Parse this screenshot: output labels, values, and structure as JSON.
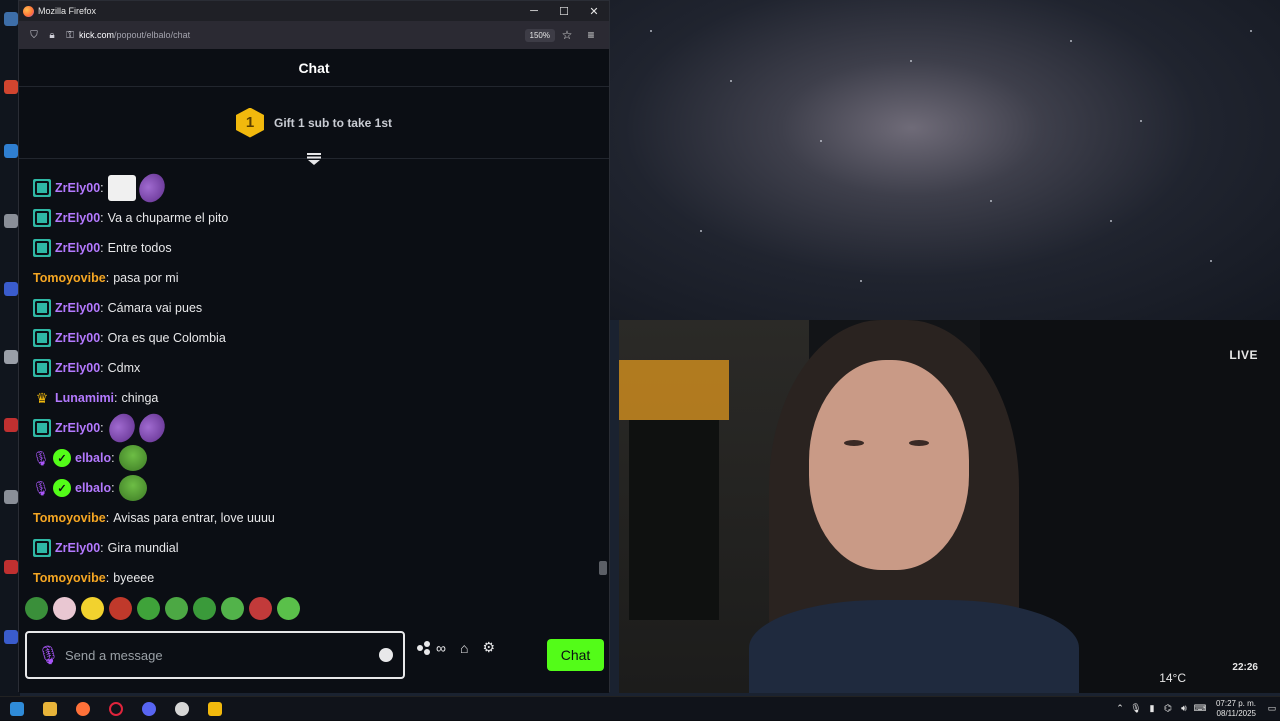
{
  "browser": {
    "window_title": "Mozilla Firefox",
    "url_host": "kick.com",
    "url_path": "/popout/elbalo/chat",
    "zoom": "150%"
  },
  "chat": {
    "header": "Chat",
    "gift_rank": "1",
    "gift_text": "Gift 1 sub to take 1st",
    "messages": [
      {
        "user": "ZrEly00",
        "text": "",
        "emotes": [
          "paper",
          "eggplant"
        ]
      },
      {
        "user": "ZrEly00",
        "text": "Va a chuparme el pito"
      },
      {
        "user": "ZrEly00",
        "text": "Entre todos"
      },
      {
        "user": "Tomoyovibe",
        "text": "pasa por mi"
      },
      {
        "user": "ZrEly00",
        "text": "Cámara vai pues"
      },
      {
        "user": "ZrEly00",
        "text": "Ora es que Colombia"
      },
      {
        "user": "ZrEly00",
        "text": "Cdmx"
      },
      {
        "user": "Lunamimi",
        "text": "chinga"
      },
      {
        "user": "ZrEly00",
        "text": "",
        "emotes": [
          "eggplant",
          "eggplant"
        ]
      },
      {
        "user": "elbalo",
        "text": "",
        "emotes": [
          "frog"
        ]
      },
      {
        "user": "elbalo",
        "text": "",
        "emotes": [
          "frog"
        ]
      },
      {
        "user": "Tomoyovibe",
        "text": "Avisas para entrar, love uuuu"
      },
      {
        "user": "ZrEly00",
        "text": "Gira mundial"
      },
      {
        "user": "Tomoyovibe",
        "text": "byeeee"
      }
    ],
    "composer": {
      "placeholder": "Send a message",
      "send_label": "Chat"
    }
  },
  "video": {
    "live": "LIVE",
    "temperature": "14°C",
    "clock": "22:26"
  },
  "taskbar": {
    "time": "07:27 p. m.",
    "date": "08/11/2025"
  },
  "colors": {
    "kick_green": "#53fc18",
    "username_purple": "#b479ff",
    "username_orange": "#f5a623",
    "sub_badge": "#2fb8a5"
  }
}
